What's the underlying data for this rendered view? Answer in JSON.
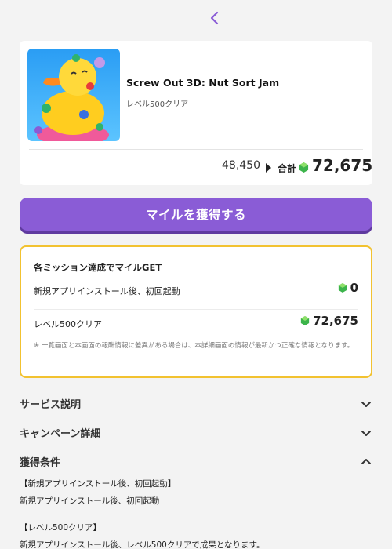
{
  "nav": {
    "back_icon": "chevron-left-icon",
    "accent": "#8a5cd6"
  },
  "app": {
    "title": "Screw Out 3D: Nut Sort Jam",
    "subtitle": "レベル500クリア",
    "thumbnail": "rubber-duck-app-icon"
  },
  "price": {
    "old": "48,450",
    "total_label": "合計",
    "total": "72,675"
  },
  "cta": {
    "label": "マイルを獲得する",
    "color": "#8a5cd6"
  },
  "missions": {
    "title": "各ミッション達成でマイルGET",
    "items": [
      {
        "label": "新規アプリインストール後、初回起動",
        "value": "0"
      },
      {
        "label": "レベル500クリア",
        "value": "72,675"
      }
    ],
    "note": "※ 一覧画面と本画面の報酬情報に差異がある場合は、本詳細画面の情報が最新かつ正確な情報となります。",
    "border_color": "#f2c230"
  },
  "sections": [
    {
      "label": "サービス説明",
      "expanded": false
    },
    {
      "label": "キャンペーン詳細",
      "expanded": false
    },
    {
      "label": "獲得条件",
      "expanded": true
    }
  ],
  "conditions": [
    "【新規アプリインストール後、初回起動】",
    "新規アプリインストール後、初回起動",
    "【レベル500クリア】",
    "新規アプリインストール後、レベル500クリアで成果となります。"
  ]
}
